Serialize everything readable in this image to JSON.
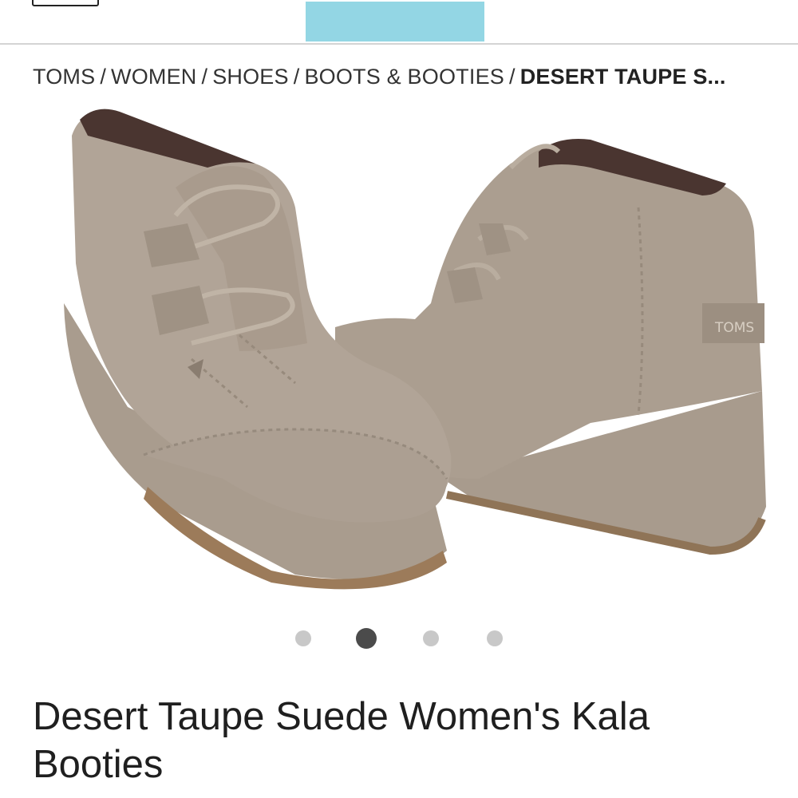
{
  "header": {
    "menu_icon": "menu-icon",
    "promo_color": "#93d6e4"
  },
  "breadcrumb": {
    "items": [
      "TOMS",
      "WOMEN",
      "SHOES",
      "BOOTS & BOOTIES"
    ],
    "separator": "/",
    "current": "DESERT TAUPE S..."
  },
  "product_image": {
    "logo_text": "TOMS",
    "colors": {
      "suede": "#a79a8c",
      "suede_light": "#b5a99b",
      "suede_dark": "#8f8275",
      "lining": "#4a3530",
      "sole": "#9c7b5a"
    }
  },
  "carousel": {
    "count": 4,
    "active_index": 1
  },
  "product": {
    "title": "Desert Taupe Suede Women's Kala Booties"
  }
}
